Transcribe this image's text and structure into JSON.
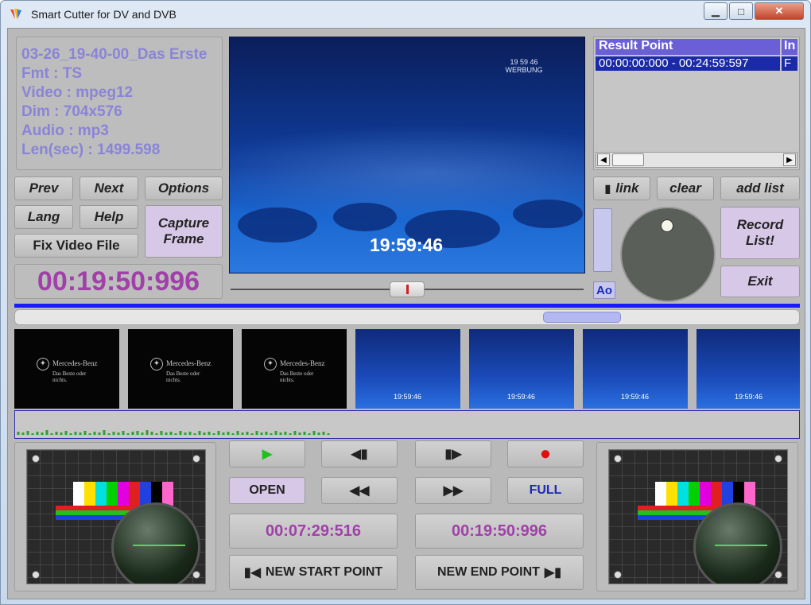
{
  "window": {
    "title": "Smart Cutter for DV and DVB",
    "minimize_glyph": "▁",
    "maximize_glyph": "□",
    "close_glyph": "✕"
  },
  "info": {
    "lines": [
      "03-26_19-40-00_Das Erste",
      "Fmt : TS",
      "Video : mpeg12",
      "Dim : 704x576",
      "Audio : mp3",
      "Len(sec) : 1499.598"
    ]
  },
  "buttons": {
    "prev": "Prev",
    "next": "Next",
    "options": "Options",
    "lang": "Lang",
    "help": "Help",
    "capture_frame": "Capture Frame",
    "fix_video_file": "Fix Video File",
    "link": "link",
    "link_glyph": "▮",
    "clear": "clear",
    "add_list": "add list",
    "record_list": "Record List!",
    "exit": "Exit",
    "ao": "Ao",
    "open": "OPEN",
    "full": "FULL",
    "new_start_point": "NEW START POINT",
    "new_end_point": "NEW END POINT"
  },
  "current_time": "00:19:50:996",
  "video": {
    "overlay_time": "19:59:46",
    "logo_line1": "19 59 46",
    "logo_line2": "WERBUNG"
  },
  "result_list": {
    "header_col1": "Result Point",
    "header_col2": "In",
    "rows": [
      {
        "range": "00:00:00:000 - 00:24:59:597",
        "flag": "F"
      }
    ]
  },
  "scroll": {
    "left": "◀",
    "right": "▶"
  },
  "thumbnails": {
    "dark_label": "Mercedes-Benz",
    "dark_sub": "Das Beste oder nichts.",
    "blue_time": "19:59:46"
  },
  "transport": {
    "play": "▶",
    "step_back": "◀▮",
    "step_forward": "▮▶",
    "record": "●",
    "rewind": "◀◀",
    "fast_forward": "▶▶",
    "start_point_glyph": "▮◀",
    "end_point_glyph": "▶▮"
  },
  "start_time": "00:07:29:516",
  "end_time": "00:19:50:996",
  "colors": {
    "accent_purple": "#a040a8",
    "info_text": "#8a84d8",
    "selection_blue": "#1a2aa8",
    "record_red": "#e01010",
    "play_green": "#20c020"
  }
}
